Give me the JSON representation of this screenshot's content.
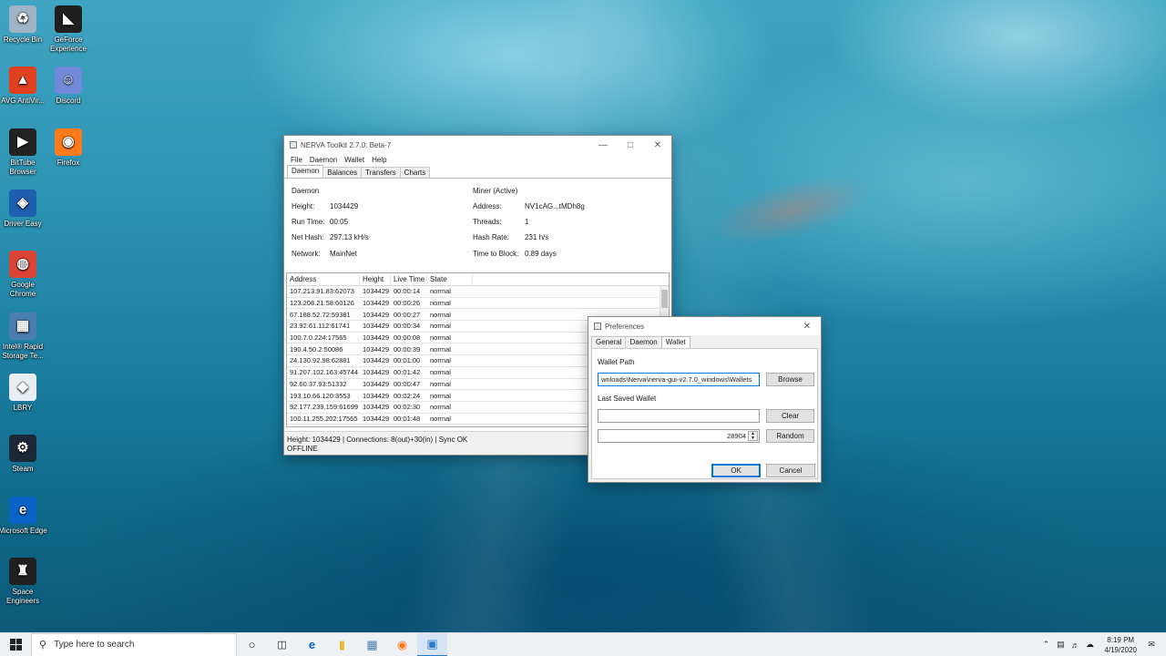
{
  "desktop": {
    "icons": [
      {
        "label": "Recycle Bin",
        "glyph": "♻",
        "icon": "recycle-bin-icon",
        "color": "#9fb4c4"
      },
      {
        "label": "GeForce Experience",
        "glyph": "◣",
        "icon": "nvidia-icon",
        "color": "#1f1f1f"
      },
      {
        "label": "AVG AntiVir...",
        "glyph": "▲",
        "icon": "avg-icon",
        "color": "#e04020"
      },
      {
        "label": "Discord",
        "glyph": "☺",
        "icon": "discord-icon",
        "color": "#7289da"
      },
      {
        "label": "BitTube Browser",
        "glyph": "▶",
        "icon": "bittube-icon",
        "color": "#222222"
      },
      {
        "label": "Firefox",
        "glyph": "◉",
        "icon": "firefox-icon",
        "color": "#ff7a1a"
      },
      {
        "label": "Driver Easy",
        "glyph": "◈",
        "icon": "driver-easy-icon",
        "color": "#1f5fb0"
      },
      {
        "label": "Google Chrome",
        "glyph": "◍",
        "icon": "chrome-icon",
        "color": "#db4437"
      },
      {
        "label": "Intel® Rapid Storage Te...",
        "glyph": "▦",
        "icon": "intel-rst-icon",
        "color": "#4a7db0"
      },
      {
        "label": "LBRY",
        "glyph": "◆",
        "icon": "lbry-icon",
        "color": "#e8eef2"
      },
      {
        "label": "Steam",
        "glyph": "⚙",
        "icon": "steam-icon",
        "color": "#1b2838"
      },
      {
        "label": "Microsoft Edge",
        "glyph": "e",
        "icon": "edge-icon",
        "color": "#0a64c8"
      },
      {
        "label": "Space Engineers",
        "glyph": "♜",
        "icon": "space-engineers-icon",
        "color": "#202020"
      }
    ]
  },
  "nerva": {
    "title": "NERVA Toolkit 2.7.0: Beta-7",
    "menu": [
      "File",
      "Daemon",
      "Wallet",
      "Help"
    ],
    "tabs": [
      "Daemon",
      "Balances",
      "Transfers",
      "Charts"
    ],
    "daemon": {
      "heading": "Daemon",
      "height_label": "Height:",
      "height_value": "1034429",
      "runtime_label": "Run Time:",
      "runtime_value": "00:05",
      "nethash_label": "Net Hash:",
      "nethash_value": "297.13 kH/s",
      "network_label": "Network:",
      "network_value": "MainNet"
    },
    "miner": {
      "heading": "Miner (Active)",
      "address_label": "Address:",
      "address_value": "NV1cAG...tMDh8g",
      "threads_label": "Threads:",
      "threads_value": "1",
      "hashrate_label": "Hash Rate:",
      "hashrate_value": "231 h/s",
      "ttb_label": "Time to Block:",
      "ttb_value": "0.89 days"
    },
    "peers": {
      "columns": [
        "Address",
        "Height",
        "Live Time",
        "State"
      ],
      "rows": [
        [
          "107.213.91.83:62073",
          "1034429",
          "00:00:14",
          "normal"
        ],
        [
          "123.208.21.58:60126",
          "1034429",
          "00:00:26",
          "normal"
        ],
        [
          "67.188.52.72:59381",
          "1034429",
          "00:00:27",
          "normal"
        ],
        [
          "23.92.61.112:61741",
          "1034429",
          "00:00:34",
          "normal"
        ],
        [
          "100.7.0.224:17565",
          "1034429",
          "00:00:08",
          "normal"
        ],
        [
          "190.4.50.2:50086",
          "1034429",
          "00:00:39",
          "normal"
        ],
        [
          "24.130.92.98:62881",
          "1034429",
          "00:01:00",
          "normal"
        ],
        [
          "91.207.102.163:45744",
          "1034429",
          "00:01:42",
          "normal"
        ],
        [
          "92.60.37.93:51332",
          "1034429",
          "00:00:47",
          "normal"
        ],
        [
          "193.10.66.120:3553",
          "1034429",
          "00:02:24",
          "normal"
        ],
        [
          "92.177.239.159:61699",
          "1034429",
          "00:02:30",
          "normal"
        ],
        [
          "100.11.255.202:17565",
          "1034429",
          "00:01:48",
          "normal"
        ]
      ]
    },
    "status_line1": "Height: 1034429 | Connections: 8(out)+30(in) | Sync OK",
    "status_line2": "OFFLINE"
  },
  "prefs": {
    "title": "Preferences",
    "tabs": [
      "General",
      "Daemon",
      "Wallet"
    ],
    "wallet_path_label": "Wallet Path",
    "wallet_path_value": "wnloads\\Nerva\\nerva-gui-v2.7.0_windows\\Wallets",
    "browse_label": "Browse",
    "last_saved_label": "Last Saved Wallet",
    "last_saved_value": "",
    "clear_label": "Clear",
    "port_value": "28904",
    "random_label": "Random",
    "ok_label": "OK",
    "cancel_label": "Cancel"
  },
  "taskbar": {
    "search_placeholder": "Type here to search",
    "time": "8:19 PM",
    "date": "4/19/2020",
    "accent": "#2a74c9"
  }
}
